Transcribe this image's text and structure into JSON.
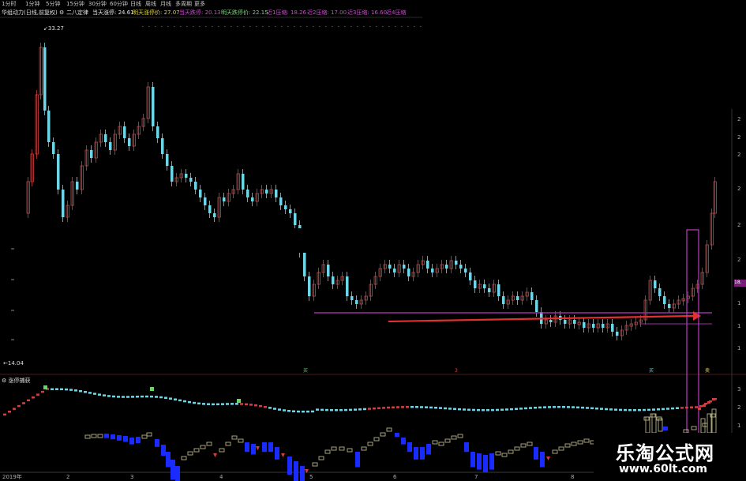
{
  "toolbar": {
    "items": [
      "1分时",
      "1分钟",
      "5分钟",
      "15分钟",
      "30分钟",
      "60分钟",
      "日线",
      "周线",
      "月线",
      "多周期",
      "更多"
    ]
  },
  "info": {
    "indicator": "华组动力(日线,前复权)",
    "icon": "gear-icon",
    "formula": "二八定律",
    "today_stop": "当天涨停: 24.61",
    "tomorrow_stop": "明天涨停价: 27.07",
    "today_limit": "当天跌停: 20.13",
    "tomorrow_limit": "明天跌停价: 22.15",
    "r1": "近1压缩: 18.26",
    "r2": "近2压缩: 17.00",
    "r3": "近3压缩: 16.60",
    "r4": "近4压缩"
  },
  "price": {
    "high_label": "33.27",
    "low_label": "14.04",
    "current_tag": "18."
  },
  "markers": {
    "buy1": "买",
    "mid": "3",
    "buy2": "买",
    "sell": "卖"
  },
  "lower_panel": {
    "title": "涨停捕获",
    "icon": "gear-icon"
  },
  "axis": {
    "year": "2019年",
    "months": [
      "2",
      "3",
      "4",
      "5",
      "6",
      "7",
      "8"
    ]
  },
  "right_axis": {
    "ticks": [
      "2",
      "2",
      "2",
      "2",
      "2",
      "2",
      "1",
      "1",
      "1"
    ],
    "lower_ticks": [
      "3",
      "2",
      "1"
    ]
  },
  "watermark": {
    "title": "乐淘公式网",
    "url": "www.60lt.com"
  },
  "colors": {
    "up": "#d04040",
    "down": "#6fd6e8",
    "blue": "#1a2bff",
    "olive": "#b9b48a",
    "magenta": "#c23bc2",
    "red_arrow": "#e03030"
  }
}
